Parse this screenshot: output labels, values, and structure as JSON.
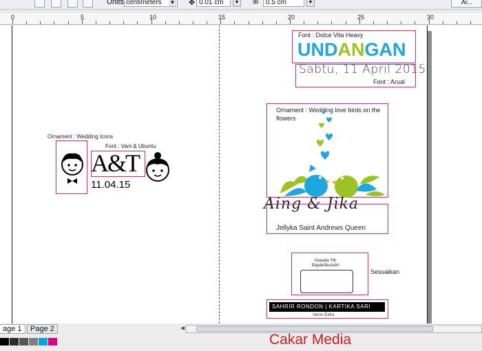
{
  "toolbar": {
    "units_label": "Units:",
    "units_value": "centimeters",
    "nudge_value": "0.01 cm",
    "duplicate_value": "0.5 cm",
    "right_cut_label": "Ar..."
  },
  "ruler": {
    "labels": [
      "0",
      "5",
      "10",
      "15",
      "20",
      "25",
      "30"
    ]
  },
  "left_page": {
    "ornament_label": "Ornament : Wedding Icons",
    "font_label": "Font : Vani & Ubuntu",
    "monogram": "A&T",
    "date": "11.04.15"
  },
  "right_page": {
    "title_font_label": "Font : Dolce Vita Heavy",
    "title": "UNDANGAN",
    "title_letters": [
      "U",
      "N",
      "D",
      "A",
      "N",
      "G",
      "A",
      "N"
    ],
    "date_script": "Sabtu, 11 April 2015",
    "date_font_label": "Font : Arual",
    "birds_label": "Ornament : Wedding love birds on the flowers",
    "names_script": "Aing & Jika",
    "names_font_label": "Jellyka Saint Andrews Queen",
    "address_line1": "Kepada Yth",
    "address_line2": "Bapak/ibu/sdr/i",
    "address_note": "Sesuaikan",
    "banner_text": "SAHRIR RONDON | KARTIKA SARI",
    "banner_font_label": "Veron Extra"
  },
  "pages": {
    "tab1": "age 1",
    "tab2": "Page 2"
  },
  "palette": [
    "#000000",
    "#2b2b2b",
    "#555555",
    "#808080",
    "#00a6e0",
    "#1b2b8c",
    "#e0007a"
  ],
  "colors": {
    "accent_pink": "#e0258c",
    "undangan_green": "#9cc31f",
    "undangan_blue": "#1ea7df"
  },
  "watermark": "Cakar Media"
}
